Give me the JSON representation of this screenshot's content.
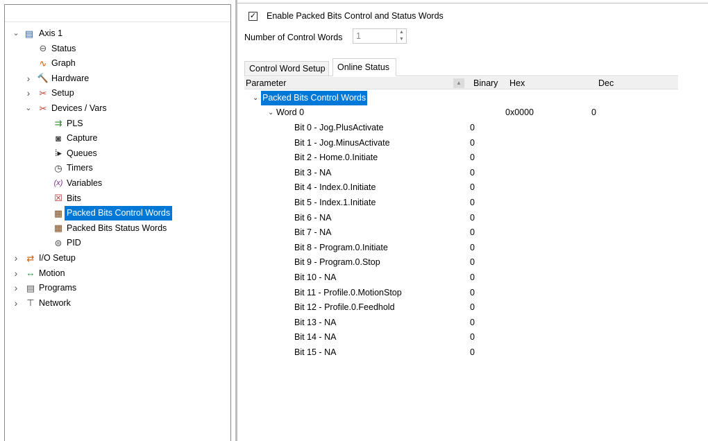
{
  "tree": {
    "items": [
      {
        "name": "tree-item-axis-1",
        "label": "Axis 1",
        "icon": "servo-drive-icon",
        "glyph": "▤",
        "color": "#2a5f9e",
        "chevron": "down",
        "level": 0
      },
      {
        "name": "tree-item-status",
        "label": "Status",
        "icon": "status-loop-icon",
        "glyph": "⊖",
        "color": "#555555",
        "chevron": "",
        "level": 1
      },
      {
        "name": "tree-item-graph",
        "label": "Graph",
        "icon": "graph-icon",
        "glyph": "∿",
        "color": "#d05a00",
        "chevron": "",
        "level": 1
      },
      {
        "name": "tree-item-hardware",
        "label": "Hardware",
        "icon": "hammer-icon",
        "glyph": "🔨",
        "color": "#555555",
        "chevron": "right",
        "level": 1
      },
      {
        "name": "tree-item-setup",
        "label": "Setup",
        "icon": "tools-icon",
        "glyph": "✂",
        "color": "#c0392b",
        "chevron": "right",
        "level": 1
      },
      {
        "name": "tree-item-devices-vars",
        "label": "Devices / Vars",
        "icon": "tools-icon",
        "glyph": "✂",
        "color": "#c0392b",
        "chevron": "down",
        "level": 1
      },
      {
        "name": "tree-item-pls",
        "label": "PLS",
        "icon": "pls-icon",
        "glyph": "⇉",
        "color": "#2e8b2e",
        "chevron": "",
        "level": 2
      },
      {
        "name": "tree-item-capture",
        "label": "Capture",
        "icon": "camera-icon",
        "glyph": "◙",
        "color": "#444444",
        "chevron": "",
        "level": 2
      },
      {
        "name": "tree-item-queues",
        "label": "Queues",
        "icon": "queue-icon",
        "glyph": "⁞▸",
        "color": "#222222",
        "chevron": "",
        "level": 2
      },
      {
        "name": "tree-item-timers",
        "label": "Timers",
        "icon": "stopwatch-icon",
        "glyph": "◷",
        "color": "#333333",
        "chevron": "",
        "level": 2
      },
      {
        "name": "tree-item-variables",
        "label": "Variables",
        "icon": "variable-x-icon",
        "glyph": "(x)",
        "color": "#7a2b8c",
        "chevron": "",
        "level": 2
      },
      {
        "name": "tree-item-bits",
        "label": "Bits",
        "icon": "checkbox-x-icon",
        "glyph": "☒",
        "color": "#b03030",
        "chevron": "",
        "level": 2
      },
      {
        "name": "tree-item-packed-bits-control-words",
        "label": "Packed Bits Control Words",
        "icon": "packed-bits-icon",
        "glyph": "▦",
        "color": "#7a4a1a",
        "chevron": "",
        "level": 2,
        "selected": true
      },
      {
        "name": "tree-item-packed-bits-status-words",
        "label": "Packed Bits Status Words",
        "icon": "packed-bits-icon",
        "glyph": "▦",
        "color": "#7a4a1a",
        "chevron": "",
        "level": 2
      },
      {
        "name": "tree-item-pid",
        "label": "PID",
        "icon": "pid-icon",
        "glyph": "⊜",
        "color": "#444444",
        "chevron": "",
        "level": 2
      },
      {
        "name": "tree-item-io-setup",
        "label": "I/O Setup",
        "icon": "io-icon",
        "glyph": "⇄",
        "color": "#d05a00",
        "chevron": "right",
        "level": 0
      },
      {
        "name": "tree-item-motion",
        "label": "Motion",
        "icon": "motion-arrow-icon",
        "glyph": "↔",
        "color": "#1e8a3a",
        "chevron": "right",
        "level": 0
      },
      {
        "name": "tree-item-programs",
        "label": "Programs",
        "icon": "document-icon",
        "glyph": "▤",
        "color": "#555555",
        "chevron": "right",
        "level": 0
      },
      {
        "name": "tree-item-network",
        "label": "Network",
        "icon": "network-icon",
        "glyph": "⊤",
        "color": "#333333",
        "chevron": "right",
        "level": 0
      }
    ]
  },
  "enable_checkbox": {
    "label": "Enable Packed Bits Control and Status Words",
    "checked": true,
    "check_glyph": "✓"
  },
  "control_words": {
    "label": "Number of Control Words",
    "value": "1"
  },
  "tabs": [
    {
      "label": "Control Word Setup",
      "active": false
    },
    {
      "label": "Online Status",
      "active": true
    }
  ],
  "grid": {
    "headers": {
      "parameter": "Parameter",
      "binary": "Binary",
      "hex": "Hex",
      "dec": "Dec"
    },
    "group": {
      "label": "Packed Bits Control Words"
    },
    "word": {
      "label": "Word 0",
      "hex": "0x0000",
      "dec": "0"
    },
    "bits": [
      {
        "label": "Bit 0 - Jog.PlusActivate",
        "binary": "0"
      },
      {
        "label": "Bit 1 - Jog.MinusActivate",
        "binary": "0"
      },
      {
        "label": "Bit 2 - Home.0.Initiate",
        "binary": "0"
      },
      {
        "label": "Bit 3 - NA",
        "binary": "0"
      },
      {
        "label": "Bit 4 - Index.0.Initiate",
        "binary": "0"
      },
      {
        "label": "Bit 5 - Index.1.Initiate",
        "binary": "0"
      },
      {
        "label": "Bit 6 - NA",
        "binary": "0"
      },
      {
        "label": "Bit 7 - NA",
        "binary": "0"
      },
      {
        "label": "Bit 8 - Program.0.Initiate",
        "binary": "0"
      },
      {
        "label": "Bit 9 - Program.0.Stop",
        "binary": "0"
      },
      {
        "label": "Bit 10 - NA",
        "binary": "0"
      },
      {
        "label": "Bit 11 - Profile.0.MotionStop",
        "binary": "0"
      },
      {
        "label": "Bit 12 - Profile.0.Feedhold",
        "binary": "0"
      },
      {
        "label": "Bit 13 - NA",
        "binary": "0"
      },
      {
        "label": "Bit 14 - NA",
        "binary": "0"
      },
      {
        "label": "Bit 15 - NA",
        "binary": "0"
      }
    ]
  },
  "colors": {
    "selection": "#0078d7",
    "border": "#8a8a8a"
  }
}
